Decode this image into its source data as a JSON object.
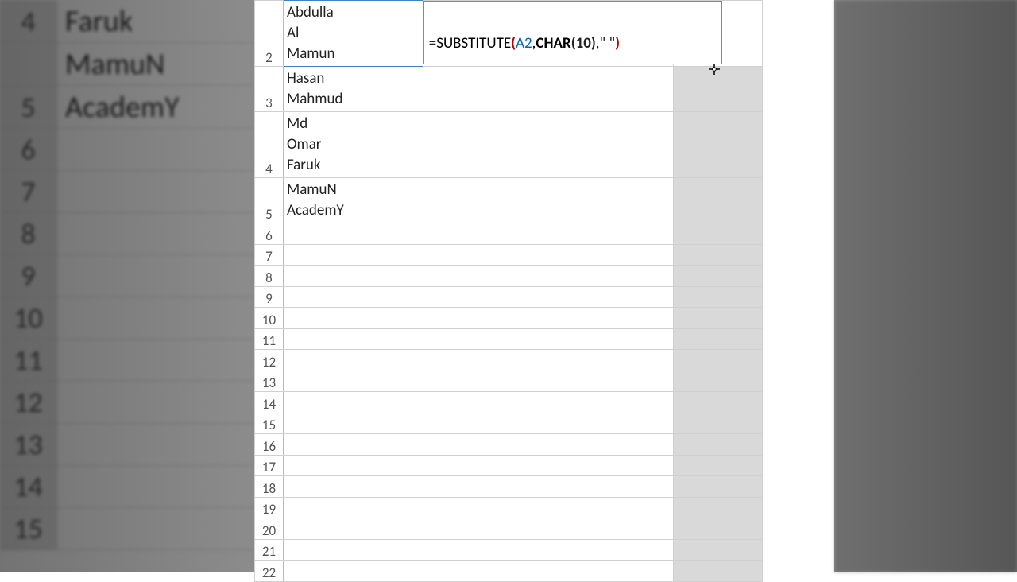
{
  "background_left": {
    "rows": [
      {
        "num": "4",
        "text": "Faruk"
      },
      {
        "num": "",
        "text": "MamuN"
      },
      {
        "num": "5",
        "text": "AcademY"
      },
      {
        "num": "6",
        "text": ""
      },
      {
        "num": "7",
        "text": ""
      },
      {
        "num": "8",
        "text": ""
      },
      {
        "num": "9",
        "text": ""
      },
      {
        "num": "10",
        "text": ""
      },
      {
        "num": "11",
        "text": ""
      },
      {
        "num": "12",
        "text": ""
      },
      {
        "num": "13",
        "text": ""
      },
      {
        "num": "14",
        "text": ""
      },
      {
        "num": "15",
        "text": ""
      }
    ]
  },
  "main": {
    "rows": {
      "2": {
        "a_lines": "Abdulla\nAl\nMamun"
      },
      "3": {
        "a_lines": "Hasan\nMahmud"
      },
      "4": {
        "a_lines": "Md\nOmar\nFaruk"
      },
      "5": {
        "a_lines": "MamuN\nAcademY"
      }
    },
    "row_numbers": [
      "2",
      "3",
      "4",
      "5",
      "6",
      "7",
      "8",
      "9",
      "10",
      "11",
      "12",
      "13",
      "14",
      "15",
      "16",
      "17",
      "18",
      "19",
      "20",
      "21",
      "22"
    ],
    "formula": {
      "eq": "=",
      "func": "SUBSTITUTE",
      "open": "(",
      "ref": "A2",
      "comma1": ",",
      "func2": "CHAR",
      "open2": "(",
      "num": "10",
      "close2": ")",
      "comma2": ",",
      "str": "\" \"",
      "close": ")"
    }
  },
  "cursor": "⊕"
}
